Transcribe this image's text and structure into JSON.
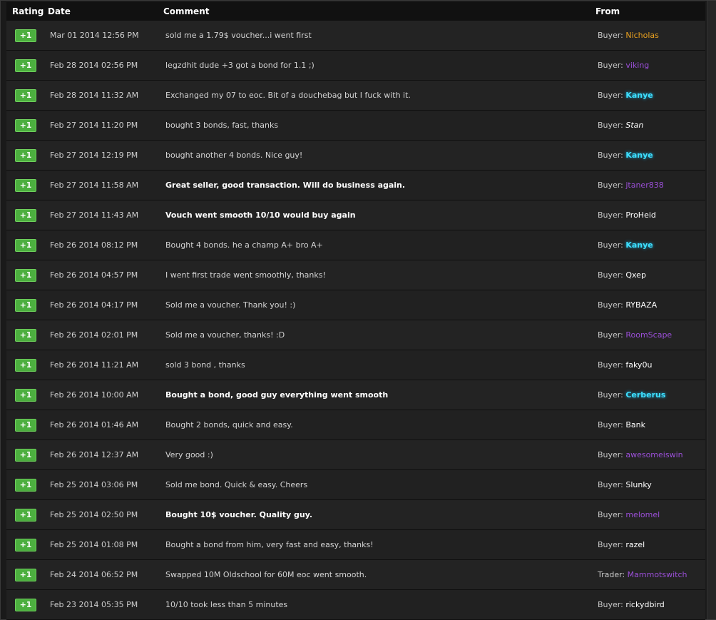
{
  "colors": {
    "badge": "#4caf3f",
    "purple": "#9b4fd8",
    "orange": "#e8a020",
    "cyan": "#3ee0ff"
  },
  "header": {
    "rating": "Rating",
    "date": "Date",
    "comment": "Comment",
    "from": "From"
  },
  "rows": [
    {
      "rating": "+1",
      "date": "Mar 01 2014 12:56 PM",
      "comment": "sold me a 1.79$ voucher...i went first",
      "bold": false,
      "role": "Buyer:",
      "name": "Nicholas",
      "style": "orange"
    },
    {
      "rating": "+1",
      "date": "Feb 28 2014 02:56 PM",
      "comment": "legzdhit dude +3 got a bond for 1.1 ;)",
      "bold": false,
      "role": "Buyer:",
      "name": "viking",
      "style": "purple"
    },
    {
      "rating": "+1",
      "date": "Feb 28 2014 11:32 AM",
      "comment": "Exchanged my 07 to eoc. Bit of a douchebag but I fuck with it.",
      "bold": false,
      "role": "Buyer:",
      "name": "Kanye",
      "style": "cyan"
    },
    {
      "rating": "+1",
      "date": "Feb 27 2014 11:20 PM",
      "comment": "bought 3 bonds, fast, thanks",
      "bold": false,
      "role": "Buyer:",
      "name": "Stan",
      "style": "italic"
    },
    {
      "rating": "+1",
      "date": "Feb 27 2014 12:19 PM",
      "comment": "bought another 4 bonds. Nice guy!",
      "bold": false,
      "role": "Buyer:",
      "name": "Kanye",
      "style": "cyan"
    },
    {
      "rating": "+1",
      "date": "Feb 27 2014 11:58 AM",
      "comment": "Great seller, good transaction. Will do business again.",
      "bold": true,
      "role": "Buyer:",
      "name": "jtaner838",
      "style": "purple"
    },
    {
      "rating": "+1",
      "date": "Feb 27 2014 11:43 AM",
      "comment": "Vouch went smooth 10/10 would buy again",
      "bold": true,
      "role": "Buyer:",
      "name": "ProHeid",
      "style": "default"
    },
    {
      "rating": "+1",
      "date": "Feb 26 2014 08:12 PM",
      "comment": "Bought 4 bonds. he a champ A+ bro A+",
      "bold": false,
      "role": "Buyer:",
      "name": "Kanye",
      "style": "cyan"
    },
    {
      "rating": "+1",
      "date": "Feb 26 2014 04:57 PM",
      "comment": "I went first trade went smoothly, thanks!",
      "bold": false,
      "role": "Buyer:",
      "name": "Qxep",
      "style": "default"
    },
    {
      "rating": "+1",
      "date": "Feb 26 2014 04:17 PM",
      "comment": "Sold me a voucher. Thank you! :)",
      "bold": false,
      "role": "Buyer:",
      "name": "RYBAZA",
      "style": "default"
    },
    {
      "rating": "+1",
      "date": "Feb 26 2014 02:01 PM",
      "comment": "Sold me a voucher, thanks! :D",
      "bold": false,
      "role": "Buyer:",
      "name": "RoomScape",
      "style": "purple"
    },
    {
      "rating": "+1",
      "date": "Feb 26 2014 11:21 AM",
      "comment": "sold 3 bond , thanks",
      "bold": false,
      "role": "Buyer:",
      "name": "faky0u",
      "style": "default"
    },
    {
      "rating": "+1",
      "date": "Feb 26 2014 10:00 AM",
      "comment": "Bought a bond, good guy everything went smooth",
      "bold": true,
      "role": "Buyer:",
      "name": "Cerberus",
      "style": "cyan"
    },
    {
      "rating": "+1",
      "date": "Feb 26 2014 01:46 AM",
      "comment": "Bought 2 bonds, quick and easy.",
      "bold": false,
      "role": "Buyer:",
      "name": "Bank",
      "style": "default"
    },
    {
      "rating": "+1",
      "date": "Feb 26 2014 12:37 AM",
      "comment": "Very good :)",
      "bold": false,
      "role": "Buyer:",
      "name": "awesomeiswin",
      "style": "purple"
    },
    {
      "rating": "+1",
      "date": "Feb 25 2014 03:06 PM",
      "comment": "Sold me bond. Quick & easy. Cheers",
      "bold": false,
      "role": "Buyer:",
      "name": "Slunky",
      "style": "default"
    },
    {
      "rating": "+1",
      "date": "Feb 25 2014 02:50 PM",
      "comment": "Bought 10$ voucher. Quality guy.",
      "bold": true,
      "role": "Buyer:",
      "name": "melomel",
      "style": "purple"
    },
    {
      "rating": "+1",
      "date": "Feb 25 2014 01:08 PM",
      "comment": "Bought a bond from him, very fast and easy, thanks!",
      "bold": false,
      "role": "Buyer:",
      "name": "razel",
      "style": "default"
    },
    {
      "rating": "+1",
      "date": "Feb 24 2014 06:52 PM",
      "comment": "Swapped 10M Oldschool for 60M eoc went smooth.",
      "bold": false,
      "role": "Trader:",
      "name": "Mammotswitch",
      "style": "purple"
    },
    {
      "rating": "+1",
      "date": "Feb 23 2014 05:35 PM",
      "comment": "10/10 took less than 5 minutes",
      "bold": false,
      "role": "Buyer:",
      "name": "rickydbird",
      "style": "default"
    }
  ]
}
